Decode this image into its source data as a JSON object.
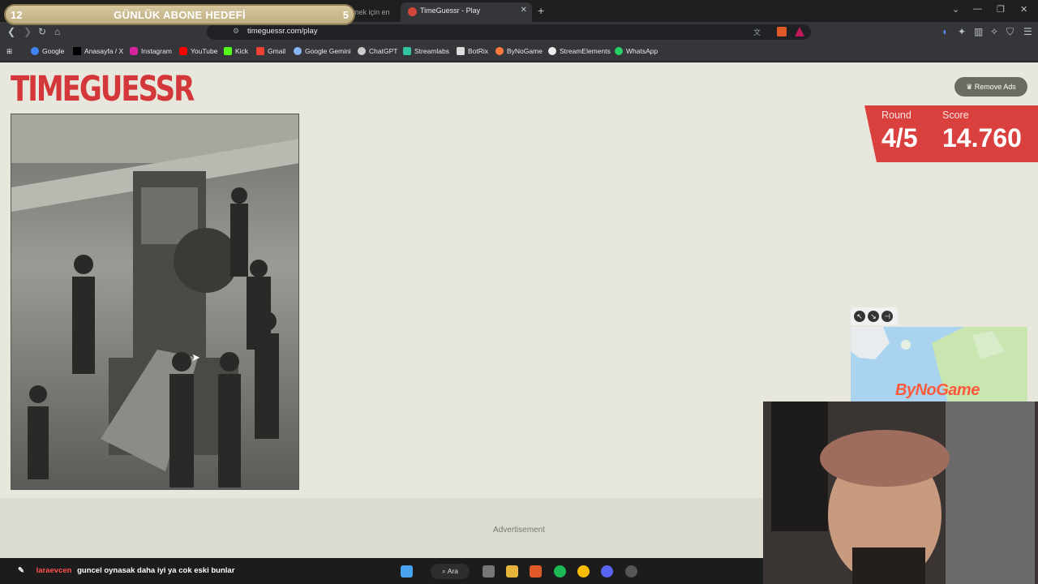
{
  "goal_widget": {
    "current": "12",
    "title": "GÜNLÜK ABONE HEDEFİ",
    "target": "5"
  },
  "tabs": [
    {
      "label": "irmek için en"
    },
    {
      "label": "TimeGuessr - Play"
    }
  ],
  "address_bar": {
    "url": "timeguessr.com/play"
  },
  "bookmarks": [
    "Google",
    "Anasayfa / X",
    "Instagram",
    "YouTube",
    "Kick",
    "Gmail",
    "Google Gemini",
    "ChatGPT",
    "Streamlabs",
    "BotRix",
    "ByNoGame",
    "StreamElements",
    "WhatsApp"
  ],
  "page": {
    "logo": "TIMEGUESSR",
    "remove_ads": "Remove Ads",
    "round_label": "Round",
    "round_value": "4/5",
    "score_label": "Score",
    "score_value": "14.760",
    "advertisement": "Advertisement"
  },
  "overlay": {
    "brand": "ByNoGame"
  },
  "chat": {
    "user": "laraevcen",
    "message": "guncel oynasak daha iyi ya cok eski bunlar"
  },
  "taskbar": {
    "search_label": "Ara"
  },
  "colors": {
    "accent_red": "#d9403e",
    "page_bg": "#e8e7dd"
  }
}
